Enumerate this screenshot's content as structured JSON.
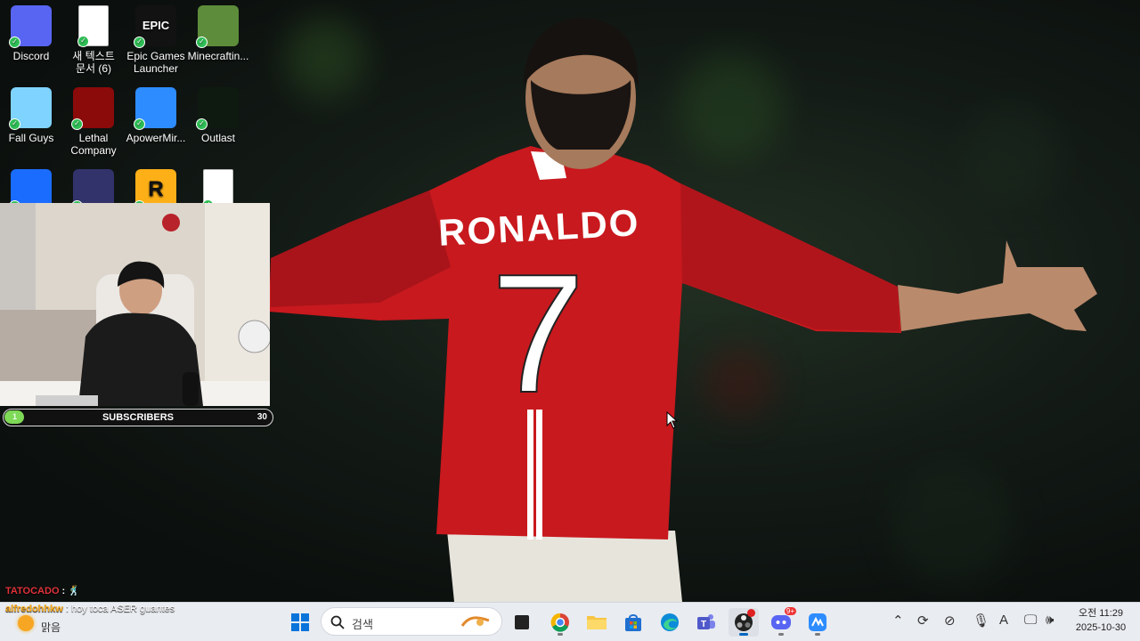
{
  "desktop_icons": [
    {
      "label": "Discord",
      "icon": "discord-icon",
      "color": "#5865f2"
    },
    {
      "label": "새 텍스트\n문서 (6)",
      "icon": "text-document-icon",
      "color": "#ffffff"
    },
    {
      "label": "Epic Games\nLauncher",
      "icon": "epic-games-icon",
      "color": "#121212",
      "glyph": "EPIC"
    },
    {
      "label": "Minecraftin...",
      "icon": "minecraft-icon",
      "color": "#5d8c3a"
    },
    {
      "label": "Fall Guys",
      "icon": "fall-guys-icon",
      "color": "#7fd3ff"
    },
    {
      "label": "Lethal\nCompany",
      "icon": "lethal-company-icon",
      "color": "#8b0a0a"
    },
    {
      "label": "ApowerMir...",
      "icon": "apowermirror-icon",
      "color": "#2d8cff"
    },
    {
      "label": "Outlast",
      "icon": "outlast-icon",
      "color": "#0e1a10"
    },
    {
      "label": "",
      "icon": "roblox-icon",
      "color": "#1a6cff"
    },
    {
      "label": "",
      "icon": "soccer-game-icon",
      "color": "#33336b"
    },
    {
      "label": "",
      "icon": "rockstar-icon",
      "color": "#fcaf17",
      "glyph": "R"
    },
    {
      "label": "",
      "icon": "document-icon",
      "color": "#ffffff"
    }
  ],
  "wallpaper": {
    "jersey_name": "RONALDO",
    "jersey_number": "7",
    "jersey_color": "#c8191e"
  },
  "subscribers": {
    "label": "SUBSCRIBERS",
    "current": "1",
    "goal": "30",
    "progress": 0.0333
  },
  "chat": [
    {
      "user": "TATOCADO",
      "sep": " : ",
      "message": "🕺",
      "user_color": "#e0313b"
    },
    {
      "user": "alfredohhkw",
      "sep": " : ",
      "message": "hoy toca ASER guantes",
      "user_color": "#ffb020"
    }
  ],
  "weather": {
    "condition": "맑음",
    "icon": "sun-icon"
  },
  "taskbar": {
    "search_placeholder": "검색",
    "apps": [
      "start-icon",
      "file-explorer-dark-icon",
      "chrome-icon",
      "folder-icon",
      "store-icon",
      "edge-icon",
      "teams-icon",
      "obs-icon",
      "discord-taskbar-icon",
      "apowermirror-taskbar-icon"
    ],
    "discord_badge": "9+"
  },
  "clock": {
    "ampm": "오전",
    "time": "11:29",
    "date": "2025-10-30"
  }
}
